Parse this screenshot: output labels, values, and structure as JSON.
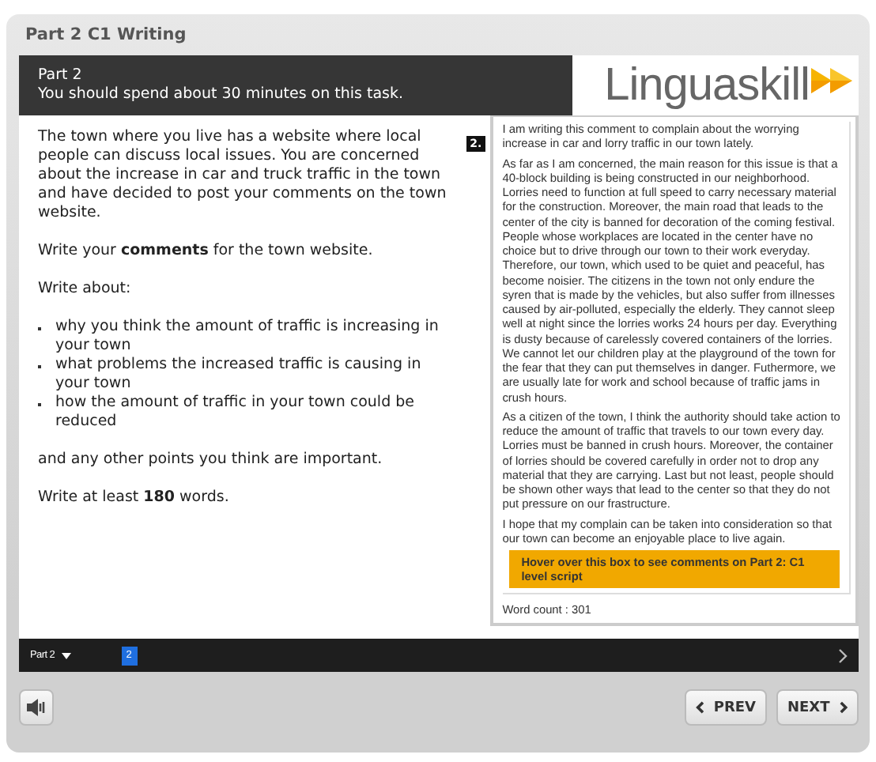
{
  "window": {
    "title": "Part 2 C1 Writing"
  },
  "header": {
    "part": "Part 2",
    "instruction": "You should spend about 30 minutes on this task."
  },
  "logo": {
    "text": "Linguaskill"
  },
  "prompt": [
    {
      "kind": "paragraph",
      "text": "The town where you live has a website where local people can discuss local issues. You are concerned about the increase in car and truck traffic in the town and have decided to post your comments on the town website."
    },
    {
      "kind": "paragraph",
      "text": "Write your **comments** for the town website."
    },
    {
      "kind": "paragraph",
      "text": "Write about:"
    },
    {
      "kind": "bullets",
      "items": [
        "why you think the amount of traffic is increasing in your town",
        "what problems the increased traffic is causing in your town",
        "how the amount of traffic in your town could be reduced"
      ]
    },
    {
      "kind": "paragraph",
      "text": "and any other points you think are important."
    },
    {
      "kind": "paragraph",
      "text": "Write at least **180** words."
    }
  ],
  "answer": {
    "number": "2.",
    "paragraphs": [
      "I am writing this comment to complain about the worrying increase in car and lorry traffic in our town lately.",
      "As far as I am concerned, the main reason for this issue is that a 40-block building is being constructed in our neighborhood. Lorries need to function at full speed to carry necessary material for the construction. Moreover, the main road that leads to the center of the city is banned for decoration of the coming festival. People whose workplaces are located in the center have no choice but to drive through our town to their work everyday. Therefore, our town, which used to be quiet and peaceful, has become noisier. The citizens in the town not only endure the syren that is made by the vehicles, but also suffer from illnesses caused by air-polluted, especially the elderly. They cannot sleep well at night since the lorries works 24 hours per day. Everything is dusty because of carelessly covered containers of the lorries. We cannot let our children play at the playground of the town for the fear that they can put themselves in danger. Futhermore, we are usually late for work and school because of traffic jams in crush hours.",
      "As a citizen of the town, I think the authority should take action to reduce the amount of traffic that travels to our town every day. Lorries must be banned in crush hours. Moreover, the container of lorries should be covered carefully in order not to drop any material that they are carrying. Last but not least, people should be shown other ways that lead to the center so that they do not put pressure on our frastructure.",
      "I hope that my complain can be taken into consideration so that our town can become an enjoyable place to live again."
    ],
    "hover_box": "Hover over this box to see comments on Part 2: C1 level script",
    "word_count": "Word count : 301"
  },
  "nav_bar": {
    "part_selector": "Part 2",
    "questions": [
      {
        "label": "2",
        "selected": true
      }
    ]
  },
  "buttons": [
    {
      "kind": "prev",
      "label": "PREV"
    },
    {
      "kind": "next",
      "label": "NEXT"
    }
  ]
}
